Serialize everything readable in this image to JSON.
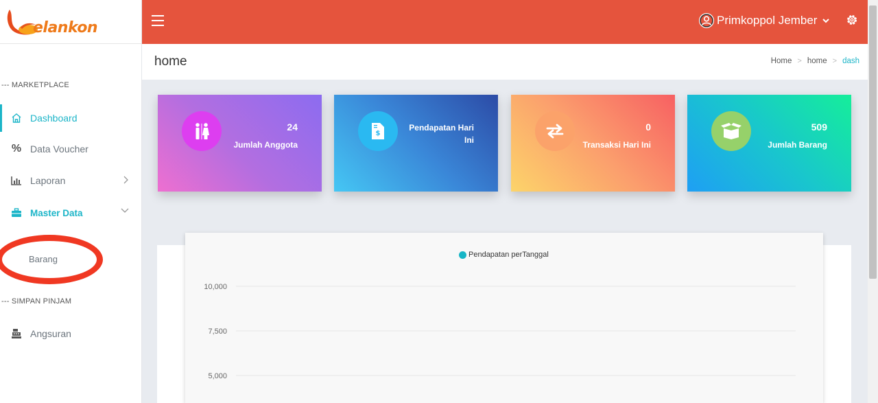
{
  "app": {
    "logo_text": "elankon",
    "brand_color": "#e5543d",
    "accent_color": "#1cb5c8"
  },
  "topbar": {
    "user_name": "Primkoppol Jember"
  },
  "sidebar": {
    "sections": [
      {
        "label": "--- MARKETPLACE"
      },
      {
        "label": "--- SIMPAN PINJAM"
      }
    ],
    "items": [
      {
        "label": "Dashboard",
        "icon": "home-icon"
      },
      {
        "label": "Data Voucher",
        "icon": "percent-icon"
      },
      {
        "label": "Laporan",
        "icon": "bar-chart-icon"
      },
      {
        "label": "Master Data",
        "icon": "briefcase-icon"
      },
      {
        "label": "Angsuran",
        "icon": "cash-register-icon"
      }
    ],
    "sub_items": [
      {
        "label": "Barang"
      }
    ]
  },
  "page": {
    "title": "home",
    "breadcrumb": [
      "Home",
      "home",
      "dash"
    ]
  },
  "cards": [
    {
      "value": "24",
      "label": "Jumlah Anggota",
      "icon": "people-icon"
    },
    {
      "value": "",
      "label": "Pendapatan Hari Ini",
      "icon": "invoice-icon"
    },
    {
      "value": "0",
      "label": "Transaksi Hari Ini",
      "icon": "exchange-icon"
    },
    {
      "value": "509",
      "label": "Jumlah Barang",
      "icon": "box-icon"
    }
  ],
  "chart_data": {
    "type": "line",
    "title": "",
    "series": [
      {
        "name": "Pendapatan perTanggal",
        "color": "#17b5c6",
        "values": []
      }
    ],
    "y_ticks": [
      "10,000",
      "7,500",
      "5,000"
    ],
    "ylim": [
      5000,
      10000
    ],
    "grid": true,
    "legend_position": "top"
  }
}
